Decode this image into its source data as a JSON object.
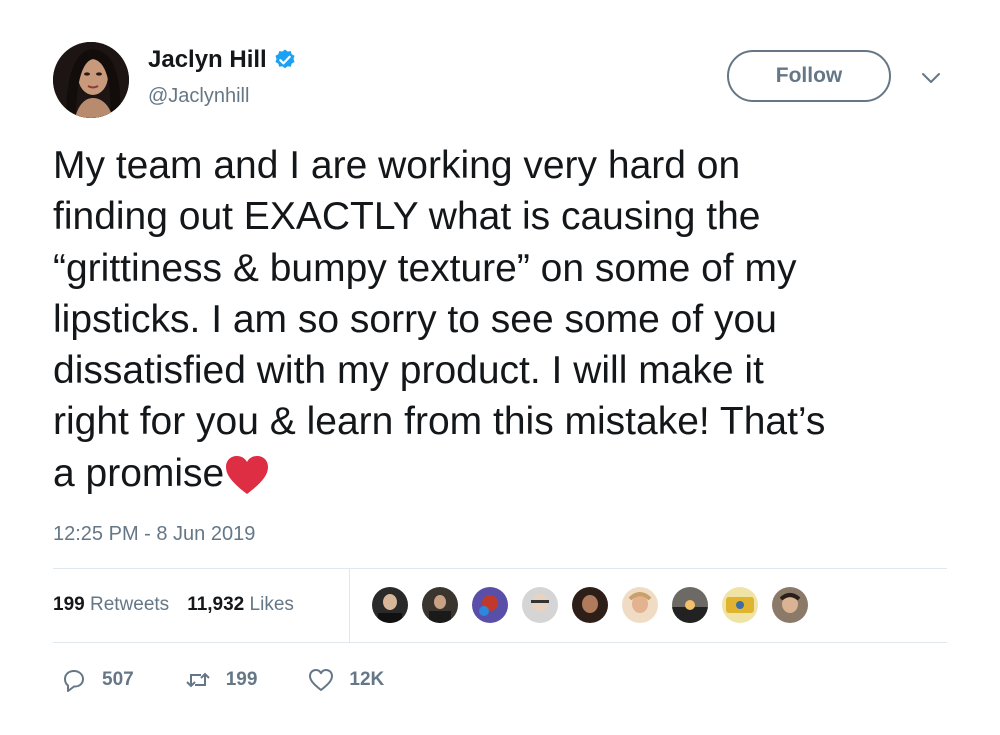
{
  "user": {
    "display_name": "Jaclyn Hill",
    "handle": "@Jaclynhill",
    "verified": true
  },
  "header": {
    "follow_label": "Follow"
  },
  "tweet": {
    "lines": [
      "My team and I are working very hard on",
      "finding out EXACTLY what is causing the",
      "“grittiness & bumpy texture” on some of my",
      "lipsticks. I am so sorry to see some of you",
      "dissatisfied with my product. I will make it",
      "right for you & learn from this mistake! That’s",
      "a promise"
    ],
    "emoji": "red-heart-emoji",
    "timestamp": "12:25 PM - 8 Jun 2019"
  },
  "stats": {
    "retweets_count": "199",
    "retweets_label": "Retweets",
    "likes_count": "11,932",
    "likes_label": "Likes"
  },
  "liker_avatars": [
    {
      "color": "#2a2a2a"
    },
    {
      "color": "#3b3530"
    },
    {
      "color": "#5a4fa8"
    },
    {
      "color": "#b9b9b9"
    },
    {
      "color": "#5a3a2e"
    },
    {
      "color": "#e6c7a8"
    },
    {
      "color": "#3d3a36"
    },
    {
      "color": "#e8c45a"
    },
    {
      "color": "#6b5a48"
    }
  ],
  "actions": {
    "replies": "507",
    "retweets": "199",
    "likes": "12K"
  },
  "colors": {
    "text": "#14171a",
    "secondary": "#657786",
    "verified": "#1da1f2",
    "heart": "#e0245e",
    "divider": "#e1e8ed"
  }
}
